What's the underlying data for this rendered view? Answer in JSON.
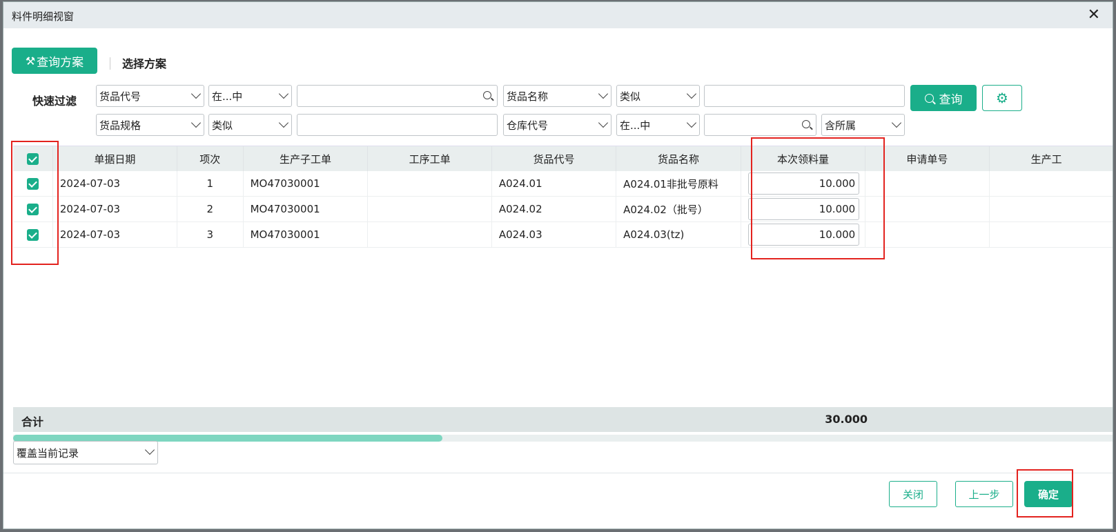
{
  "window": {
    "title": "料件明细视窗"
  },
  "tabs": {
    "query_scheme": "查询方案",
    "choose_scheme": "选择方案"
  },
  "quick_filter": {
    "label": "快速过滤",
    "row1": [
      {
        "field": "货品代号",
        "op": "在...中",
        "value": ""
      },
      {
        "field": "货品名称",
        "op": "类似",
        "value": ""
      }
    ],
    "row2": [
      {
        "field": "货品规格",
        "op": "类似",
        "value": ""
      },
      {
        "field": "仓库代号",
        "op": "在...中",
        "value": ""
      }
    ],
    "scope": "含所属",
    "query_button": "查询"
  },
  "table": {
    "columns": [
      "单据日期",
      "项次",
      "生产子工单",
      "工序工单",
      "货品代号",
      "货品名称",
      "本次领料量",
      "申请单号",
      "生产工"
    ],
    "rows": [
      {
        "date": "2024-07-03",
        "seq": "1",
        "sub_order": "MO47030001",
        "proc_order": "",
        "code": "A024.01",
        "name": "A024.01非批号原料",
        "qty": "10.000",
        "req_no": ""
      },
      {
        "date": "2024-07-03",
        "seq": "2",
        "sub_order": "MO47030001",
        "proc_order": "",
        "code": "A024.02",
        "name": "A024.02（批号）",
        "qty": "10.000",
        "req_no": ""
      },
      {
        "date": "2024-07-03",
        "seq": "3",
        "sub_order": "MO47030001",
        "proc_order": "",
        "code": "A024.03",
        "name": "A024.03(tz)",
        "qty": "10.000",
        "req_no": ""
      }
    ],
    "total_label": "合计",
    "total_qty": "30.000",
    "scroll_position": 0.0,
    "scroll_visible_fraction": 0.39
  },
  "footer": {
    "mode": "覆盖当前记录",
    "close": "关闭",
    "prev": "上一步",
    "confirm": "确定"
  },
  "colors": {
    "accent": "#1aae8a",
    "highlight": "#e3221e"
  }
}
